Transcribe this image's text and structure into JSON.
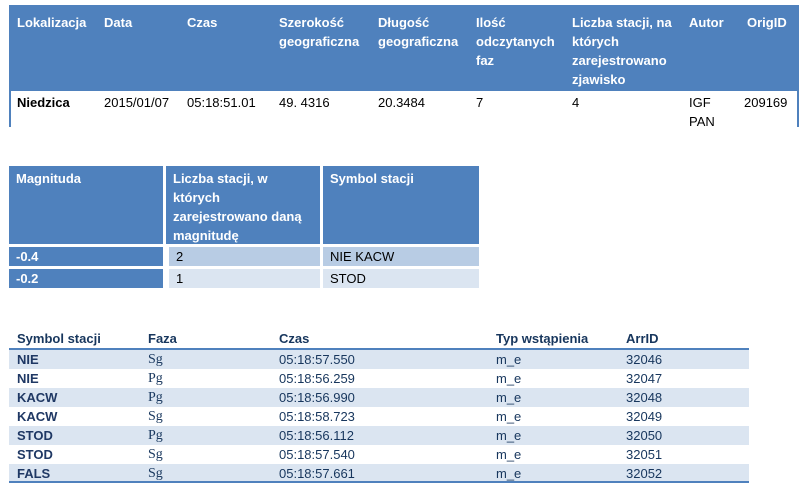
{
  "event_table": {
    "headers": {
      "location": "Lokalizacja",
      "date": "Data",
      "time": "Czas",
      "latitude": "Szerokość geograficzna",
      "longitude": "Długość geograficzna",
      "phases": "Ilość odczytanych faz",
      "stations": "Liczba stacji, na których zarejestrowano zjawisko",
      "author": "Autor",
      "origid": "OrigID"
    },
    "row": {
      "location": "Niedzica",
      "date": "2015/01/07",
      "time": "05:18:51.01",
      "latitude": "49. 4316",
      "longitude": "20.3484",
      "phases": "7",
      "stations": "4",
      "author": "IGF PAN",
      "origid": "209169"
    }
  },
  "magnitude_table": {
    "headers": {
      "magnitude": "Magnituda",
      "count": "Liczba stacji, w których zarejestrowano daną magnitudę",
      "symbol": "Symbol stacji"
    },
    "rows": [
      {
        "magnitude": "-0.4",
        "count": "2",
        "symbol": "NIE KACW"
      },
      {
        "magnitude": "-0.2",
        "count": "1",
        "symbol": "STOD"
      }
    ]
  },
  "arrivals_table": {
    "headers": {
      "symbol": "Symbol stacji",
      "phase": "Faza",
      "time": "Czas",
      "onset": "Typ wstąpienia",
      "arrid": "ArrID"
    },
    "rows": [
      {
        "symbol": "NIE",
        "phase": "Sg",
        "time": "05:18:57.550",
        "onset": "m_e",
        "arrid": "32046"
      },
      {
        "symbol": "NIE",
        "phase": "Pg",
        "time": "05:18:56.259",
        "onset": "m_e",
        "arrid": "32047"
      },
      {
        "symbol": "KACW",
        "phase": "Pg",
        "time": "05:18:56.990",
        "onset": "m_e",
        "arrid": "32048"
      },
      {
        "symbol": "KACW",
        "phase": "Sg",
        "time": "05:18:58.723",
        "onset": "m_e",
        "arrid": "32049"
      },
      {
        "symbol": "STOD",
        "phase": "Pg",
        "time": "05:18:56.112",
        "onset": "m_e",
        "arrid": "32050"
      },
      {
        "symbol": "STOD",
        "phase": "Sg",
        "time": "05:18:57.540",
        "onset": "m_e",
        "arrid": "32051"
      },
      {
        "symbol": "FALS",
        "phase": "Sg",
        "time": "05:18:57.661",
        "onset": "m_e",
        "arrid": "32052"
      }
    ]
  }
}
